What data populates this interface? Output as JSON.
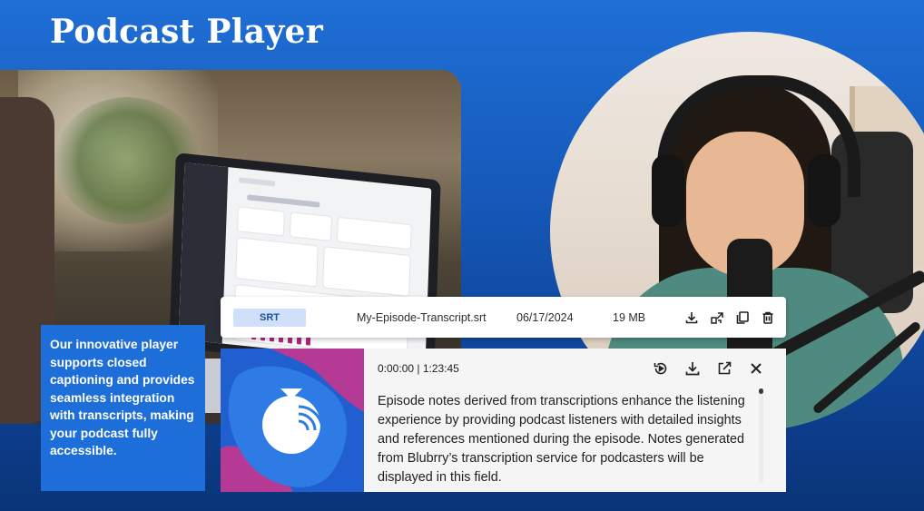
{
  "page": {
    "title": "Podcast Player"
  },
  "file_row": {
    "format": "SRT",
    "filename": "My-Episode-Transcript.srt",
    "date": "06/17/2024",
    "size": "19 MB",
    "actions": [
      "download-icon",
      "share-icon",
      "copy-icon",
      "trash-icon"
    ]
  },
  "info_box": {
    "text": "Our innovative player supports closed captioning and provides seamless integration with transcripts, making your podcast fully accessible."
  },
  "player": {
    "time": "0:00:00 | 1:23:45",
    "notes": "Episode notes derived from transcriptions enhance the listening experience by providing podcast listeners with detailed insights and references mentioned during the episode. Notes generated from Blubrry’s transcription service for podcasters will be displayed in this field.",
    "actions": [
      "replay-icon",
      "download-icon",
      "open-external-icon",
      "close-icon"
    ]
  },
  "colors": {
    "background_top": "#1f6fd6",
    "background_bottom": "#0a3478",
    "info_box": "#1d6ed8",
    "badge_bg": "#cfe0f8",
    "brand_magenta": "#b43a96"
  }
}
